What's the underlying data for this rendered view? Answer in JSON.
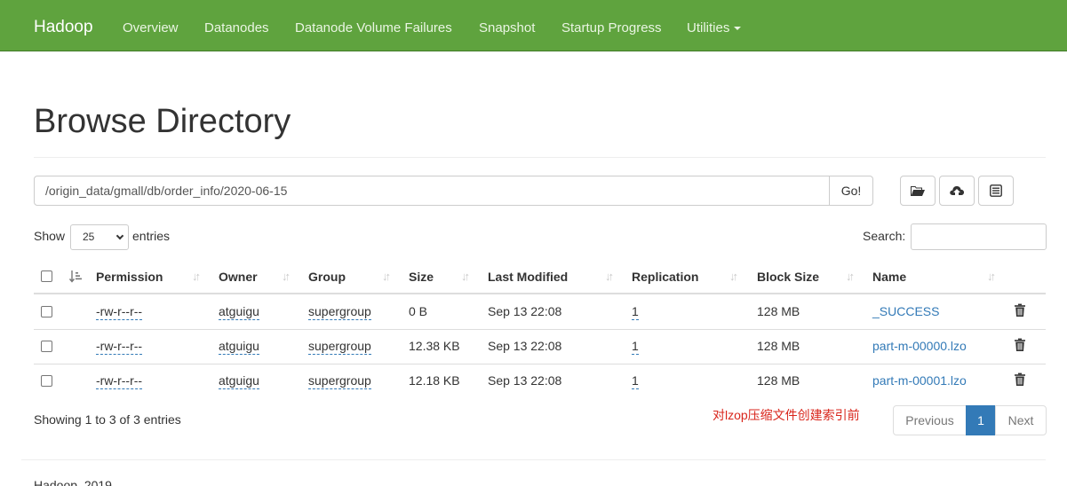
{
  "navbar": {
    "brand": "Hadoop",
    "items": [
      "Overview",
      "Datanodes",
      "Datanode Volume Failures",
      "Snapshot",
      "Startup Progress",
      "Utilities"
    ]
  },
  "page": {
    "title": "Browse Directory"
  },
  "path_bar": {
    "value": "/origin_data/gmall/db/order_info/2020-06-15",
    "go_label": "Go!"
  },
  "toolbar": {
    "icons": [
      "folder-open-icon",
      "cloud-upload-icon",
      "list-alt-icon"
    ]
  },
  "table_controls": {
    "show_label": "Show",
    "page_size": "25",
    "entries_label": "entries",
    "search_label": "Search:"
  },
  "table": {
    "columns": [
      "Permission",
      "Owner",
      "Group",
      "Size",
      "Last Modified",
      "Replication",
      "Block Size",
      "Name"
    ],
    "rows": [
      {
        "permission": "-rw-r--r--",
        "owner": "atguigu",
        "group": "supergroup",
        "size": "0 B",
        "modified": "Sep 13 22:08",
        "replication": "1",
        "block_size": "128 MB",
        "name": "_SUCCESS"
      },
      {
        "permission": "-rw-r--r--",
        "owner": "atguigu",
        "group": "supergroup",
        "size": "12.38 KB",
        "modified": "Sep 13 22:08",
        "replication": "1",
        "block_size": "128 MB",
        "name": "part-m-00000.lzo"
      },
      {
        "permission": "-rw-r--r--",
        "owner": "atguigu",
        "group": "supergroup",
        "size": "12.18 KB",
        "modified": "Sep 13 22:08",
        "replication": "1",
        "block_size": "128 MB",
        "name": "part-m-00001.lzo"
      }
    ]
  },
  "summary": {
    "showing": "Showing 1 to 3 of 3 entries",
    "annotation": "对lzop压缩文件创建索引前"
  },
  "pagination": {
    "previous": "Previous",
    "current": "1",
    "next": "Next"
  },
  "footer": {
    "text": "Hadoop, 2019."
  },
  "colors": {
    "navbar": "#5fa33e",
    "link": "#337ab7",
    "annotation": "#d9261c"
  }
}
